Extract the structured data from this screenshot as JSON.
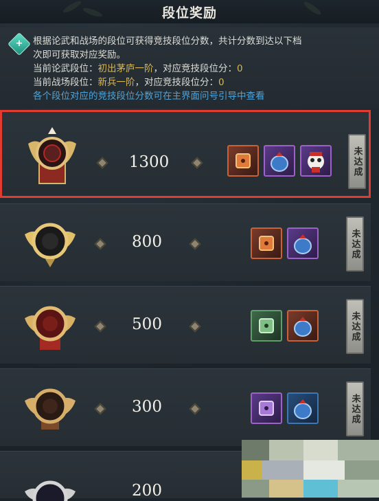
{
  "header": {
    "title": "段位奖励"
  },
  "info": {
    "icon": "info-diamond-icon",
    "line1": "根据论武和战场的段位可获得竞技段位分数，共计分数到达以下档",
    "line2": "次即可获取对应奖励。",
    "lunwu_prefix": "当前论武段位：",
    "lunwu_rank": "初出茅庐一阶",
    "lunwu_mid": "，对应竞技段位分：",
    "lunwu_score": "0",
    "zhanchang_prefix": "当前战场段位：",
    "zhanchang_rank": "新兵一阶",
    "zhanchang_mid": "，对应竞技段位分：",
    "zhanchang_score": "0",
    "link": "各个段位对应的竞技段位分数可在主界面问号引导中查看"
  },
  "tiers": [
    {
      "score": "1300",
      "status": "未达成",
      "items": [
        "dice-gold",
        "pouch-blue",
        "panda-mascot"
      ]
    },
    {
      "score": "800",
      "status": "未达成",
      "items": [
        "dice-gold",
        "pouch-blue"
      ]
    },
    {
      "score": "500",
      "status": "未达成",
      "items": [
        "dice-green",
        "pouch-blue-red"
      ]
    },
    {
      "score": "300",
      "status": "未达成",
      "items": [
        "dice-purple",
        "pouch-blue-plain"
      ]
    },
    {
      "score": "200"
    }
  ],
  "colors": {
    "highlight_border": "#e23b30",
    "rank_text": "#d6b658",
    "link_text": "#4fa3d8"
  }
}
